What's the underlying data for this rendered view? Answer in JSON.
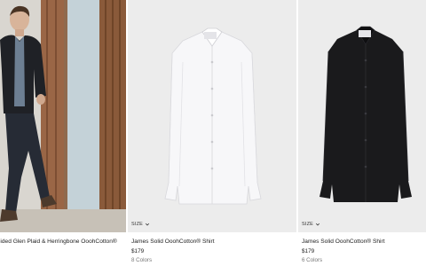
{
  "products": [
    {
      "name": "Sided Glen Plaid & Herringbone OoohCotton®",
      "price": "",
      "colors": ""
    },
    {
      "size_label": "SIZE",
      "name": "James Solid OoohCotton® Shirt",
      "price": "$179",
      "colors": "8 Colors",
      "shirt_color": "#f7f7f9"
    },
    {
      "size_label": "SIZE",
      "name": "James Solid OoohCotton® Shirt",
      "price": "$179",
      "colors": "6 Colors",
      "shirt_color": "#1a1a1c"
    }
  ]
}
